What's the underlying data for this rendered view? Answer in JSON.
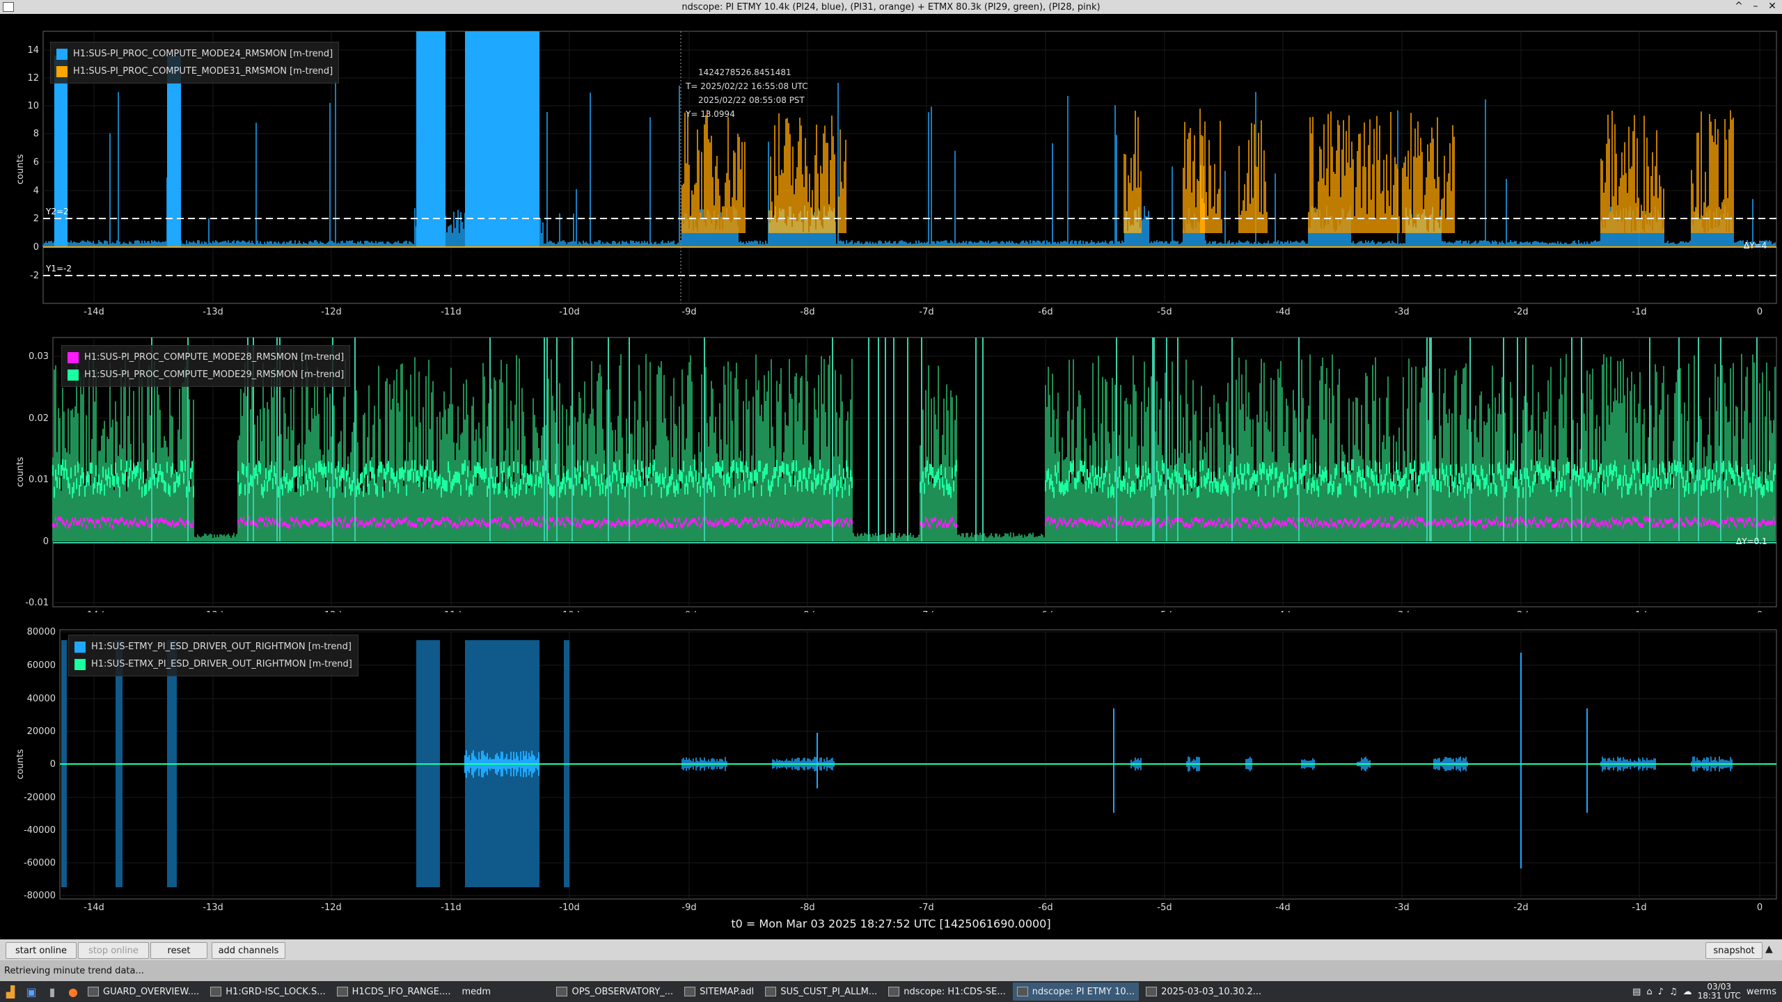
{
  "window": {
    "title": "ndscope: PI ETMY 10.4k (PI24, blue), (PI31, orange) + ETMX 80.3k (PI29, green), (PI28, pink)",
    "controls": [
      "^",
      "–",
      "✕"
    ]
  },
  "plots": [
    {
      "ylabel": "counts",
      "yticks": [
        "14",
        "12",
        "10",
        "8",
        "6",
        "4",
        "2",
        "0",
        "-2"
      ],
      "legend": [
        {
          "label": "H1:SUS-PI_PROC_COMPUTE_MODE24_RMSMON [m-trend]",
          "color": "#1ea8ff"
        },
        {
          "label": "H1:SUS-PI_PROC_COMPUTE_MODE31_RMSMON [m-trend]",
          "color": "#ffa500"
        }
      ],
      "cursor_lines": {
        "y2_label": "Y2=2",
        "y1_label": "Y1=-2",
        "dy_label": "ΔY=4"
      },
      "cursor_info": {
        "gps": "1424278526.8451481",
        "utc": "T= 2025/02/22 16:55:08 UTC",
        "pst": "2025/02/22 08:55:08 PST",
        "y": "Y= 13.0994"
      }
    },
    {
      "ylabel": "counts",
      "yticks": [
        "0.03",
        "0.02",
        "0.01",
        "0",
        "-0.01"
      ],
      "legend": [
        {
          "label": "H1:SUS-PI_PROC_COMPUTE_MODE28_RMSMON [m-trend]",
          "color": "#ff1aff"
        },
        {
          "label": "H1:SUS-PI_PROC_COMPUTE_MODE29_RMSMON [m-trend]",
          "color": "#1affa0"
        }
      ],
      "dy_label": "ΔY=0.1"
    },
    {
      "ylabel": "counts",
      "yticks": [
        "80000",
        "60000",
        "40000",
        "20000",
        "0",
        "-20000",
        "-40000",
        "-60000",
        "-80000"
      ],
      "legend": [
        {
          "label": "H1:SUS-ETMY_PI_ESD_DRIVER_OUT_RIGHTMON [m-trend]",
          "color": "#1ea8ff"
        },
        {
          "label": "H1:SUS-ETMX_PI_ESD_DRIVER_OUT_RIGHTMON [m-trend]",
          "color": "#1affa0"
        }
      ]
    }
  ],
  "xticks": [
    "-14d",
    "-13d",
    "-12d",
    "-11d",
    "-10d",
    "-9d",
    "-8d",
    "-7d",
    "-6d",
    "-5d",
    "-4d",
    "-3d",
    "-2d",
    "-1d",
    "0"
  ],
  "t0": "t0 = Mon Mar 03 2025 18:27:52 UTC [1425061690.0000]",
  "buttons": {
    "start_online": "start online",
    "stop_online": "stop online",
    "reset": "reset",
    "add_channels": "add channels",
    "snapshot": "snapshot"
  },
  "status": "Retrieving minute trend data...",
  "taskbar": {
    "tasks": [
      "GUARD_OVERVIEW....",
      "H1:GRD-ISC_LOCK.S...",
      "H1CDS_IFO_RANGE....",
      "medm",
      "OPS_OBSERVATORY_...",
      "SITEMAP.adl",
      "SUS_CUST_PI_ALLM...",
      "ndscope: H1:CDS-SE...",
      "ndscope: PI ETMY 10...",
      "2025-03-03_10.30.2..."
    ],
    "clock_date": "03/03",
    "clock_time": "18:31 UTC",
    "user": "werms"
  }
}
